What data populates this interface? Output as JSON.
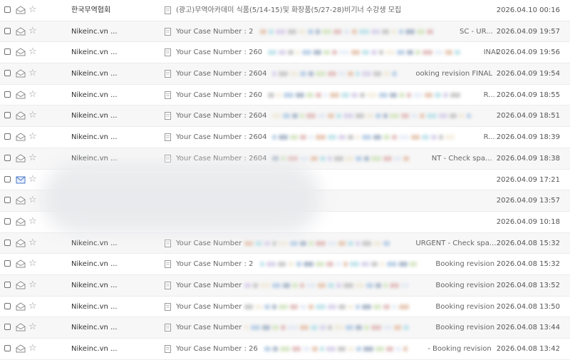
{
  "mail_list": {
    "rows": [
      {
        "sender": "한국무역협회",
        "subject": "(광고)무역아카데미 식품(5/14-15)및 화장품(5/27-28)비기너 수강생 모집",
        "tail": "",
        "date": "2026.04.10 00:16",
        "icon": "envelope-open-icon",
        "alt": false
      },
      {
        "sender": "Nikeinc.vn ...",
        "subject": "Your Case Number : 2",
        "tail": "SC - UR...",
        "date": "2026.04.09 19:57",
        "icon": "envelope-open-icon",
        "alt": true
      },
      {
        "sender": "Nikeinc.vn ...",
        "subject": "Your Case Number : 260",
        "tail": "INAL",
        "date": "2026.04.09 19:56",
        "icon": "envelope-open-icon",
        "alt": false
      },
      {
        "sender": "Nikeinc.vn ...",
        "subject": "Your Case Number : 2604",
        "tail": "ooking revision FINAL",
        "date": "2026.04.09 19:54",
        "icon": "envelope-open-icon",
        "alt": true
      },
      {
        "sender": "Nikeinc.vn ...",
        "subject": "Your Case Number : 260",
        "tail": "R...",
        "date": "2026.04.09 18:55",
        "icon": "envelope-open-icon",
        "alt": false
      },
      {
        "sender": "Nikeinc.vn ...",
        "subject": "Your Case Number : 2604",
        "tail": "",
        "date": "2026.04.09 18:51",
        "icon": "envelope-open-icon",
        "alt": true
      },
      {
        "sender": "Nikeinc.vn ...",
        "subject": "Your Case Number : 2604",
        "tail": "R...",
        "date": "2026.04.09 18:39",
        "icon": "envelope-open-icon",
        "alt": false
      },
      {
        "sender": "Nikeinc.vn ...",
        "subject": "Your Case Number : 2604",
        "tail": "NT - Check spa...",
        "date": "2026.04.09 18:38",
        "icon": "envelope-open-icon",
        "alt": true
      },
      {
        "sender": "",
        "subject": "",
        "tail": "",
        "date": "2026.04.09 17:21",
        "icon": "envelope-unread-icon",
        "alt": false
      },
      {
        "sender": "",
        "subject": "",
        "tail": "",
        "date": "2026.04.09 13:57",
        "icon": "envelope-open-icon",
        "alt": true
      },
      {
        "sender": "",
        "subject": "",
        "tail": "",
        "date": "2026.04.09 10:18",
        "icon": "envelope-open-icon",
        "alt": false
      },
      {
        "sender": "Nikeinc.vn ...",
        "subject": "Your Case Number",
        "tail": "URGENT - Check spa...",
        "date": "2026.04.08 15:32",
        "icon": "envelope-open-icon",
        "alt": true
      },
      {
        "sender": "Nikeinc.vn ...",
        "subject": "Your Case Number : 2",
        "tail": "Booking revision",
        "date": "2026.04.08 15:32",
        "icon": "envelope-open-icon",
        "alt": false
      },
      {
        "sender": "Nikeinc.vn ...",
        "subject": "Your Case Number",
        "tail": "Booking revision",
        "date": "2026.04.08 13:52",
        "icon": "envelope-open-icon",
        "alt": true
      },
      {
        "sender": "Nikeinc.vn ...",
        "subject": "Your Case Number",
        "tail": "Booking revision",
        "date": "2026.04.08 13:50",
        "icon": "envelope-open-icon",
        "alt": false
      },
      {
        "sender": "Nikeinc.vn ...",
        "subject": "Your Case Number",
        "tail": "Booking revision",
        "date": "2026.04.08 13:44",
        "icon": "envelope-open-icon",
        "alt": true
      },
      {
        "sender": "Nikeinc.vn ...",
        "subject": "Your Case Number : 26",
        "tail": "- Booking revision",
        "date": "2026.04.08 13:42",
        "icon": "envelope-open-icon",
        "alt": false
      }
    ]
  },
  "colors": {
    "blur_palette": [
      "#c9d8ee",
      "#e6c7b3",
      "#bfe3ea",
      "#d9d1ea",
      "#c7c7c7",
      "#e8d8b5",
      "#b9cfe6",
      "#a9b7c9",
      "#d6e6c4",
      "#e3bfbf"
    ]
  }
}
